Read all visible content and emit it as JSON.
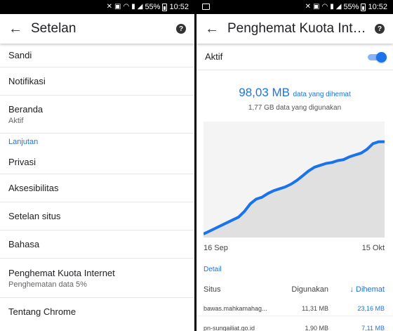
{
  "status": {
    "battery": "55%",
    "time": "10:52"
  },
  "left": {
    "title": "Setelan",
    "items": [
      {
        "label": "Sandi"
      },
      {
        "label": "Notifikasi"
      },
      {
        "label": "Beranda",
        "sub": "Aktif"
      }
    ],
    "section": "Lanjutan",
    "items2": [
      {
        "label": "Privasi"
      },
      {
        "label": "Aksesibilitas"
      },
      {
        "label": "Setelan situs"
      },
      {
        "label": "Bahasa"
      },
      {
        "label": "Penghemat Kuota Internet",
        "sub": "Penghematan data 5%"
      },
      {
        "label": "Tentang Chrome"
      }
    ]
  },
  "right": {
    "title": "Penghemat Kuota Int…",
    "toggle_label": "Aktif",
    "toggle_on": true,
    "saved_value": "98,03 MB",
    "saved_text": "data yang dihemat",
    "used_text": "1,77 GB data yang digunakan",
    "x_start": "16 Sep",
    "x_end": "15 Okt",
    "detail": "Detail",
    "table": {
      "headers": [
        "Situs",
        "Digunakan",
        "↓ Dihemat"
      ],
      "rows": [
        [
          "bawas.mahkamahag...",
          "11,31 MB",
          "23,16 MB"
        ],
        [
          "pn-sungailiat.go.id",
          "1,90 MB",
          "7,11 MB"
        ]
      ]
    }
  },
  "colors": {
    "accent": "#1a73e8",
    "chart_fill": "#e0e0e0"
  },
  "chart_data": {
    "type": "area",
    "x_labels": [
      "16 Sep",
      "15 Okt"
    ],
    "series": [
      {
        "values": [
          0,
          3,
          6,
          9,
          12,
          15,
          18,
          24,
          32,
          37,
          39,
          43,
          46,
          48,
          50,
          53,
          57,
          62,
          67,
          71,
          73,
          75,
          76,
          78,
          79,
          82,
          84,
          86,
          90,
          96,
          98,
          98.03
        ]
      }
    ],
    "ylim": [
      0,
      100
    ]
  }
}
